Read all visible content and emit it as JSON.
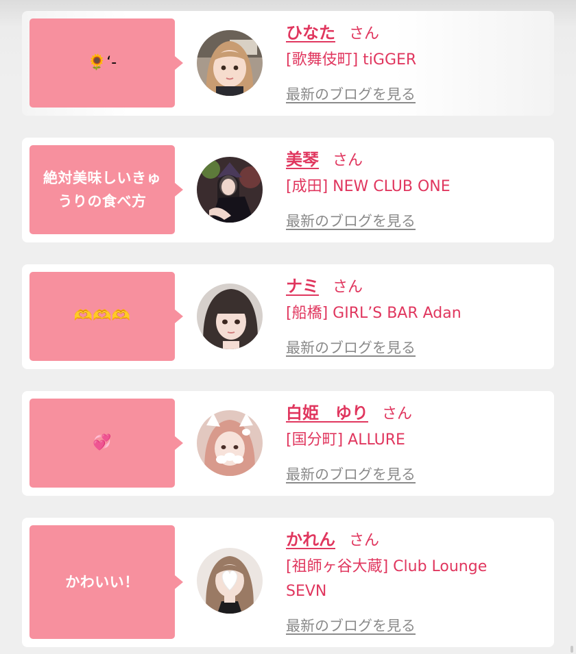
{
  "entries": [
    {
      "bubble_text": "",
      "bubble_emoji": "🌻‘-",
      "name": "ひなた",
      "honorific": "さん",
      "store": "[歌舞伎町] tiGGER",
      "store_line2": "",
      "blog_link": "最新のブログを見る"
    },
    {
      "bubble_text": "絶対美味しいきゅうりの食べ方",
      "bubble_emoji": "",
      "name": "美琴",
      "honorific": "さん",
      "store": "[成田] NEW CLUB ONE",
      "store_line2": "",
      "blog_link": "最新のブログを見る"
    },
    {
      "bubble_text": "",
      "bubble_emoji": "🫶🫶🫶",
      "name": "ナミ",
      "honorific": "さん",
      "store": "[船橋] GIRL’S BAR Adan",
      "store_line2": "",
      "blog_link": "最新のブログを見る"
    },
    {
      "bubble_text": "",
      "bubble_emoji": "💞",
      "name": "白姫　ゆり",
      "honorific": "さん",
      "store": "[国分町] ALLURE",
      "store_line2": "",
      "blog_link": "最新のブログを見る"
    },
    {
      "bubble_text": "かわいい！",
      "bubble_emoji": "",
      "name": "かれん",
      "honorific": "さん",
      "store": "[祖師ヶ谷大蔵] Club Lounge",
      "store_line2": "SEVN",
      "blog_link": "最新のブログを見る"
    }
  ],
  "colors": {
    "accent": "#e0365e",
    "bubble": "#f7909e",
    "link_gray": "#8a8a8a"
  }
}
